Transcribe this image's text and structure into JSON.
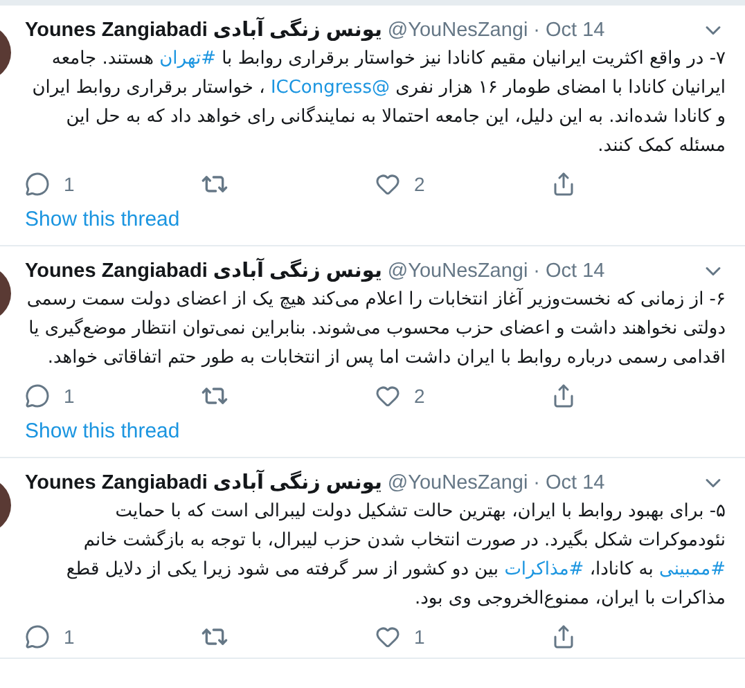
{
  "tweets": [
    {
      "author": "Younes Zangiabadi یونس زنگی آبادی",
      "handle": "@YouNesZangi",
      "date": "· Oct 14",
      "body": [
        {
          "kind": "text",
          "text": "۷- در واقع اکثریت ایرانیان مقیم کانادا نیز خواستار برقراری روابط با "
        },
        {
          "kind": "link",
          "text": "#تهران"
        },
        {
          "kind": "text",
          "text": " هستند. جامعه ایرانیان کانادا با امضای طومار ۱۶ هزار نفری "
        },
        {
          "kind": "link",
          "text": "@ICCongress"
        },
        {
          "kind": "text",
          "text": " ، خواستار برقراری روابط ایران و کانادا شده‌اند. به این دلیل، این جامعه احتمالا به نمایندگانی رای خواهد داد که به حل این مسئله کمک کنند."
        }
      ],
      "replies": "1",
      "likes": "2",
      "thread_link": "Show this thread"
    },
    {
      "author": "Younes Zangiabadi یونس زنگی آبادی",
      "handle": "@YouNesZangi",
      "date": "· Oct 14",
      "body": [
        {
          "kind": "text",
          "text": "۶- از زمانی که نخست‌وزیر آغاز انتخابات را اعلام می‌کند هیچ یک از اعضای دولت سمت رسمی دولتی نخواهند داشت و اعضای حزب محسوب می‌شوند. بنابراین نمی‌توان انتظار موضع‌گیری یا اقدامی رسمی درباره روابط با ایران داشت اما پس از انتخابات به طور حتم اتفاقاتی خواهد."
        }
      ],
      "replies": "1",
      "likes": "2",
      "thread_link": "Show this thread"
    },
    {
      "author": "Younes Zangiabadi یونس زنگی آبادی",
      "handle": "@YouNesZangi",
      "date": "· Oct 14",
      "body": [
        {
          "kind": "text",
          "text": "۵- برای بهبود روابط با ایران، بهترین حالت تشکیل دولت لیبرالی است که با حمایت نئودموکرات شکل بگیرد. در صورت انتخاب شدن حزب لیبرال، با توجه به بازگشت خانم "
        },
        {
          "kind": "link",
          "text": "#ممبینی"
        },
        {
          "kind": "text",
          "text": " به کانادا، "
        },
        {
          "kind": "link",
          "text": "#مذاکرات"
        },
        {
          "kind": "text",
          "text": " بین دو کشور از سر گرفته می شود زیرا یکی از دلایل قطع مذاکرات با ایران، ممنوع‌الخروجی وی بود."
        }
      ],
      "replies": "1",
      "likes": "1"
    }
  ]
}
